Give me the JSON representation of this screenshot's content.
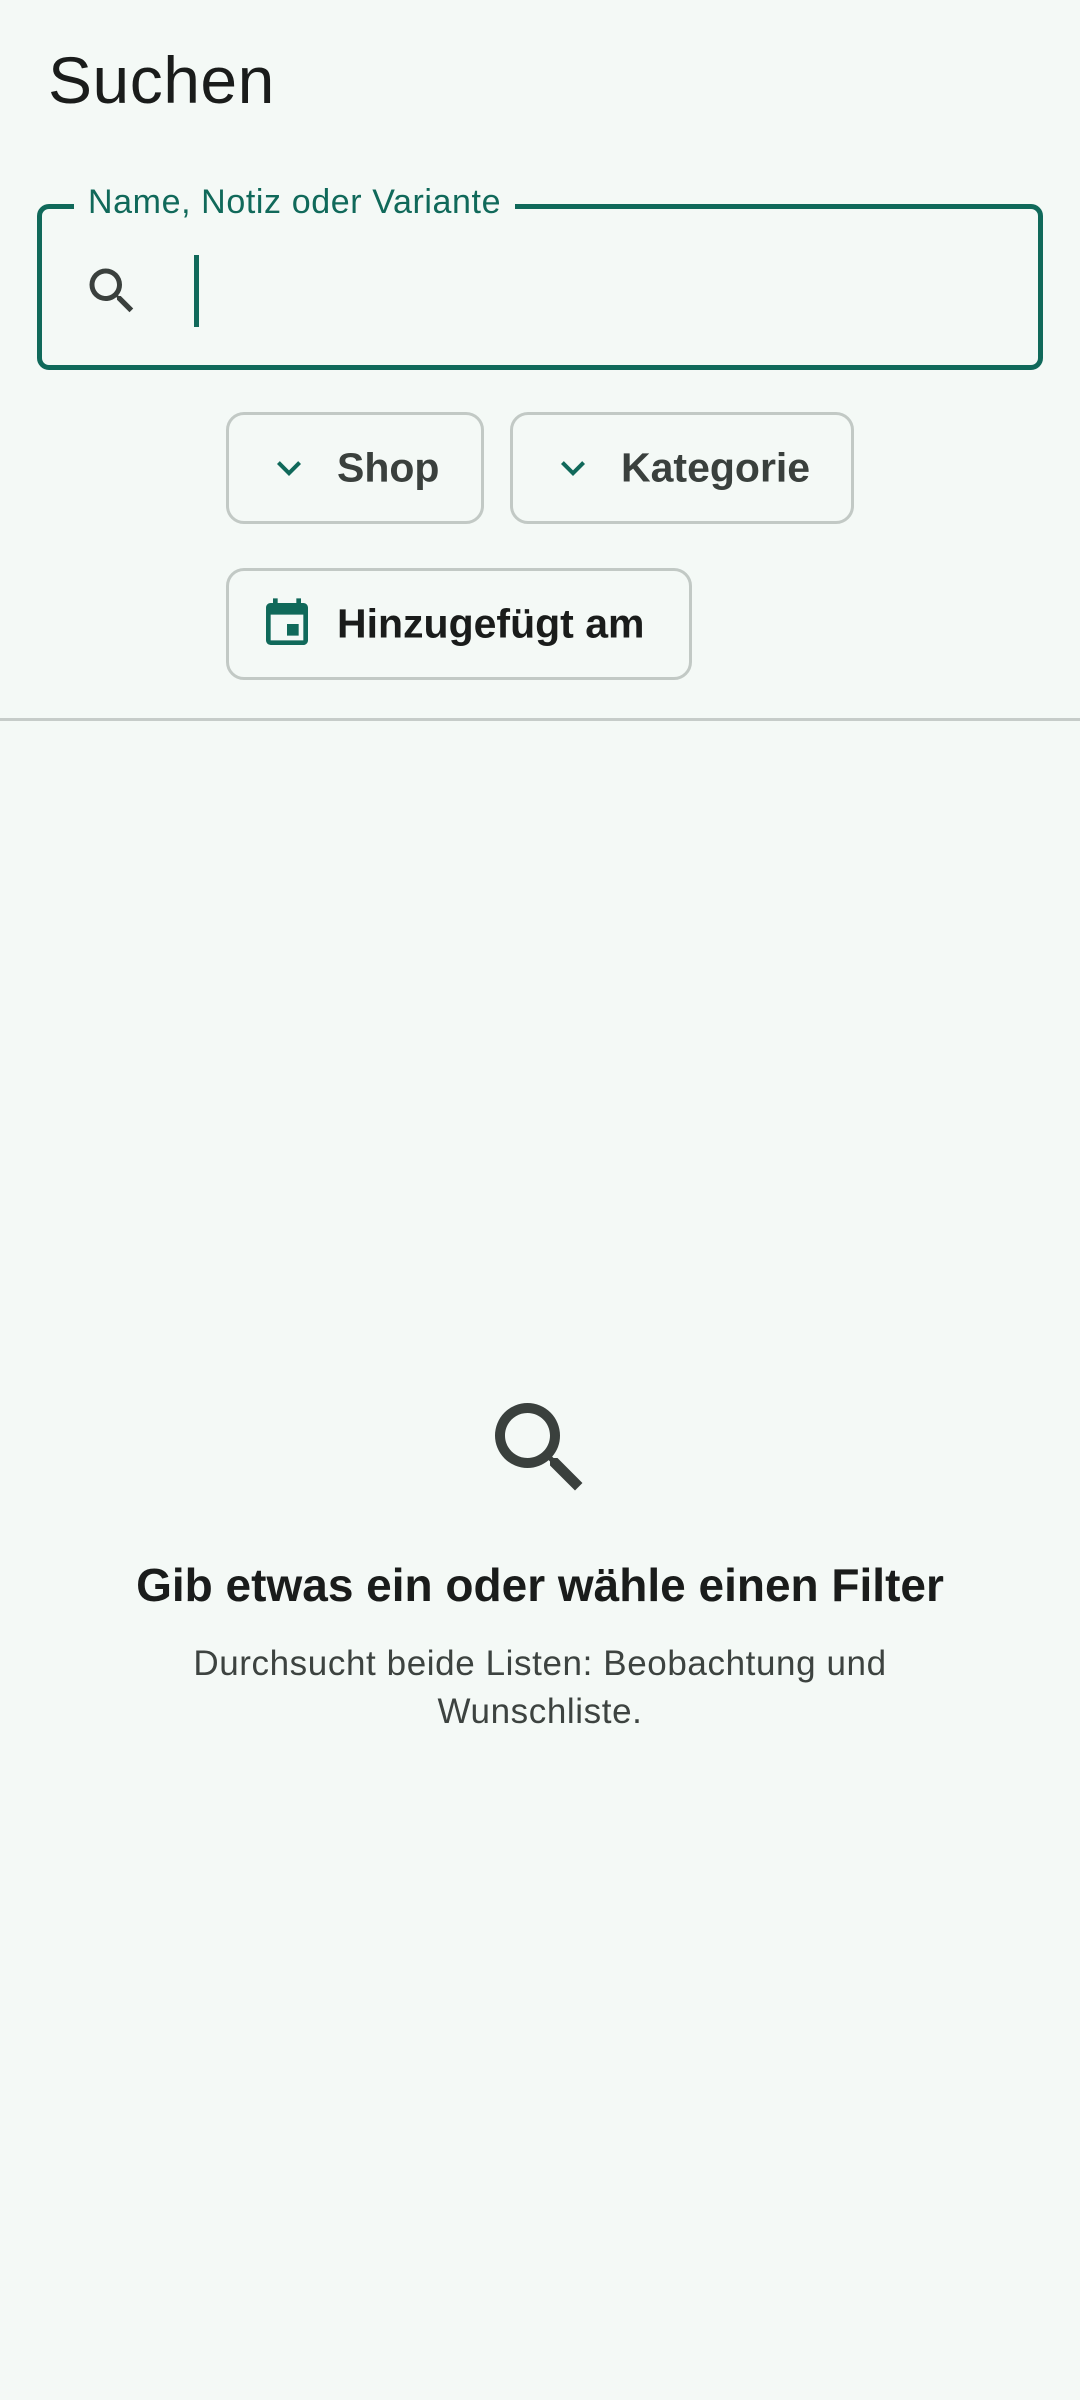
{
  "header": {
    "title": "Suchen"
  },
  "search": {
    "label": "Name, Notiz oder Variante",
    "value": "",
    "placeholder": ""
  },
  "filters": {
    "shop": {
      "label": "Shop",
      "icon": "chevron-down-icon"
    },
    "category": {
      "label": "Kategorie",
      "icon": "chevron-down-icon"
    },
    "added_on": {
      "label": "Hinzugefügt am",
      "icon": "calendar-icon"
    }
  },
  "empty_state": {
    "icon": "search-icon",
    "title": "Gib etwas ein oder wähle einen Filter",
    "subtitle": "Durchsucht beide Listen: Beobachtung und Wunschliste."
  },
  "colors": {
    "accent": "#10695a",
    "background": "#f4f9f6",
    "outline": "#c2c9c5",
    "icon": "#3a403d"
  }
}
